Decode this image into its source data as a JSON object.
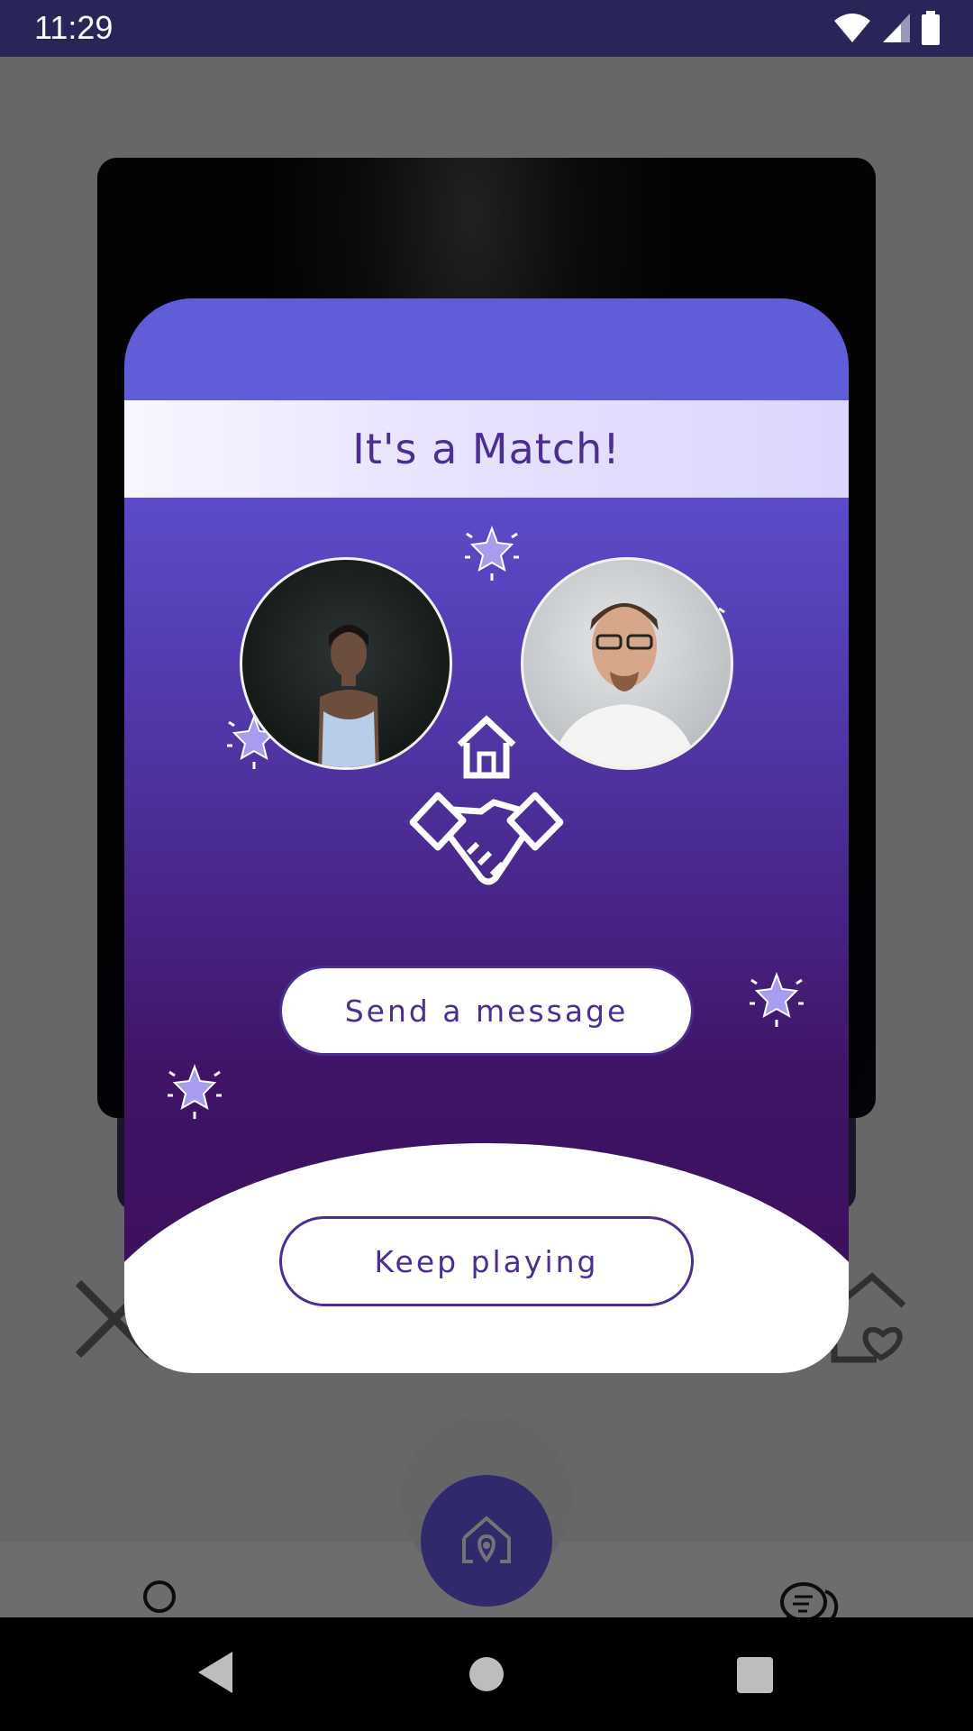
{
  "status_bar": {
    "time": "11:29",
    "icons": [
      "wifi-icon",
      "cellular-signal-icon",
      "battery-icon"
    ]
  },
  "background_app": {
    "bottom_nav": {
      "items": [
        {
          "name": "profile",
          "icon": "person-icon"
        },
        {
          "name": "home",
          "icon": "home-location-icon"
        },
        {
          "name": "chats",
          "icon": "chat-bubbles-icon"
        }
      ]
    },
    "actions": [
      "close-x-icon",
      "house-heart-icon"
    ]
  },
  "match_dialog": {
    "title": "It's a Match!",
    "center_icon": "house-handshake-icon",
    "send_message_label": "Send a message",
    "keep_playing_label": "Keep playing",
    "colors": {
      "header": "#5f5dd8",
      "gradient_top": "#5b4ac7",
      "gradient_bottom": "#3c0e5b",
      "accent_text": "#4b2d94",
      "star": "#a79cf0"
    }
  },
  "system_nav": [
    "back-button",
    "home-button",
    "recents-button"
  ]
}
